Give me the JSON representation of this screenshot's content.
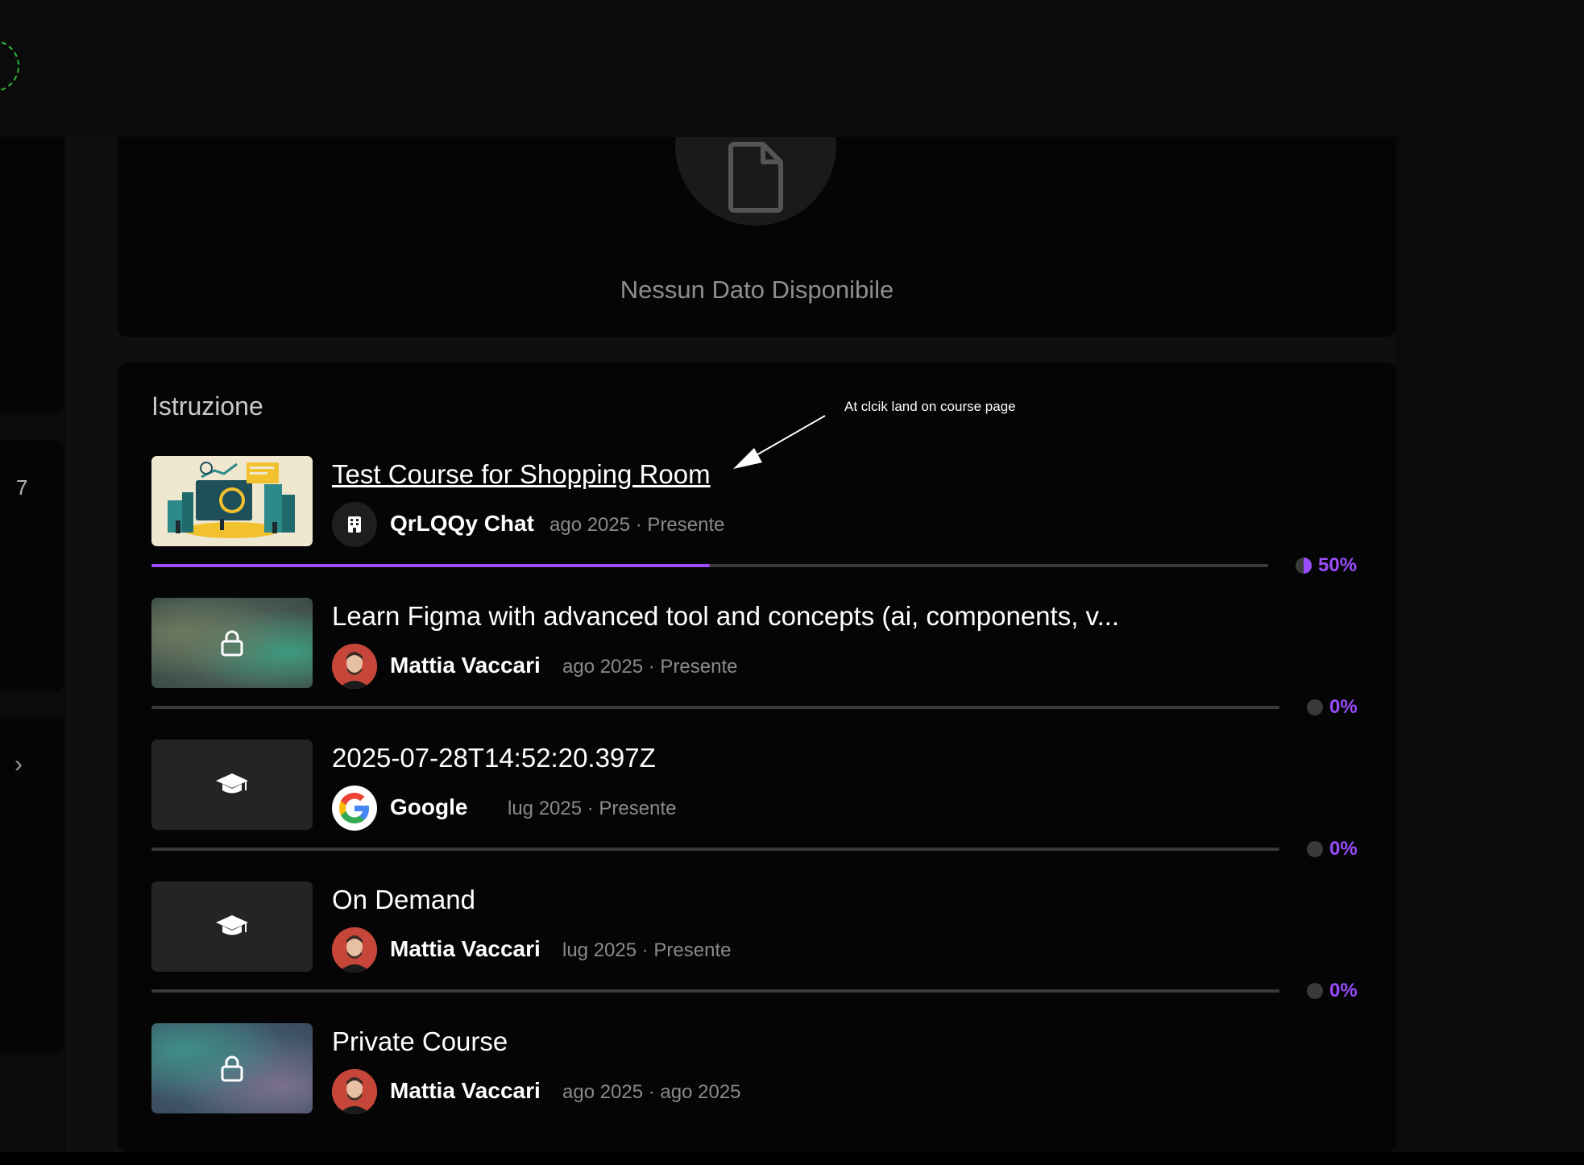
{
  "sidebar": {
    "card2_number": "7"
  },
  "empty_state": {
    "message": "Nessun Dato Disponibile"
  },
  "education": {
    "title": "Istruzione",
    "annotation": "At clcik land on course page",
    "courses": [
      {
        "title": "Test Course for Shopping Room",
        "org": "QrLQQy Chat",
        "dates": "ago 2025 · Presente",
        "progress_pct": "50%",
        "progress": 0.5,
        "thumb": "illustration",
        "avatar": "building-icon"
      },
      {
        "title": "Learn Figma with advanced tool and concepts (ai, components, v...",
        "org": "Mattia Vaccari",
        "dates": "ago 2025 · Presente",
        "progress_pct": "0%",
        "progress": 0,
        "thumb": "locked-blur",
        "avatar": "person-photo"
      },
      {
        "title": "2025-07-28T14:52:20.397Z",
        "org": "Google",
        "dates": "lug 2025 · Presente",
        "progress_pct": "0%",
        "progress": 0,
        "thumb": "graduation-cap-icon",
        "avatar": "google-logo"
      },
      {
        "title": "On Demand",
        "org": "Mattia Vaccari",
        "dates": "lug 2025 · Presente",
        "progress_pct": "0%",
        "progress": 0,
        "thumb": "graduation-cap-icon",
        "avatar": "person-photo"
      },
      {
        "title": "Private Course",
        "org": "Mattia Vaccari",
        "dates": "ago 2025 · ago 2025",
        "thumb": "locked-blur",
        "avatar": "person-photo"
      }
    ]
  },
  "colors": {
    "accent": "#9b4dff",
    "background": "#000000",
    "card": "#050505",
    "muted_text": "#8a8a8a"
  }
}
